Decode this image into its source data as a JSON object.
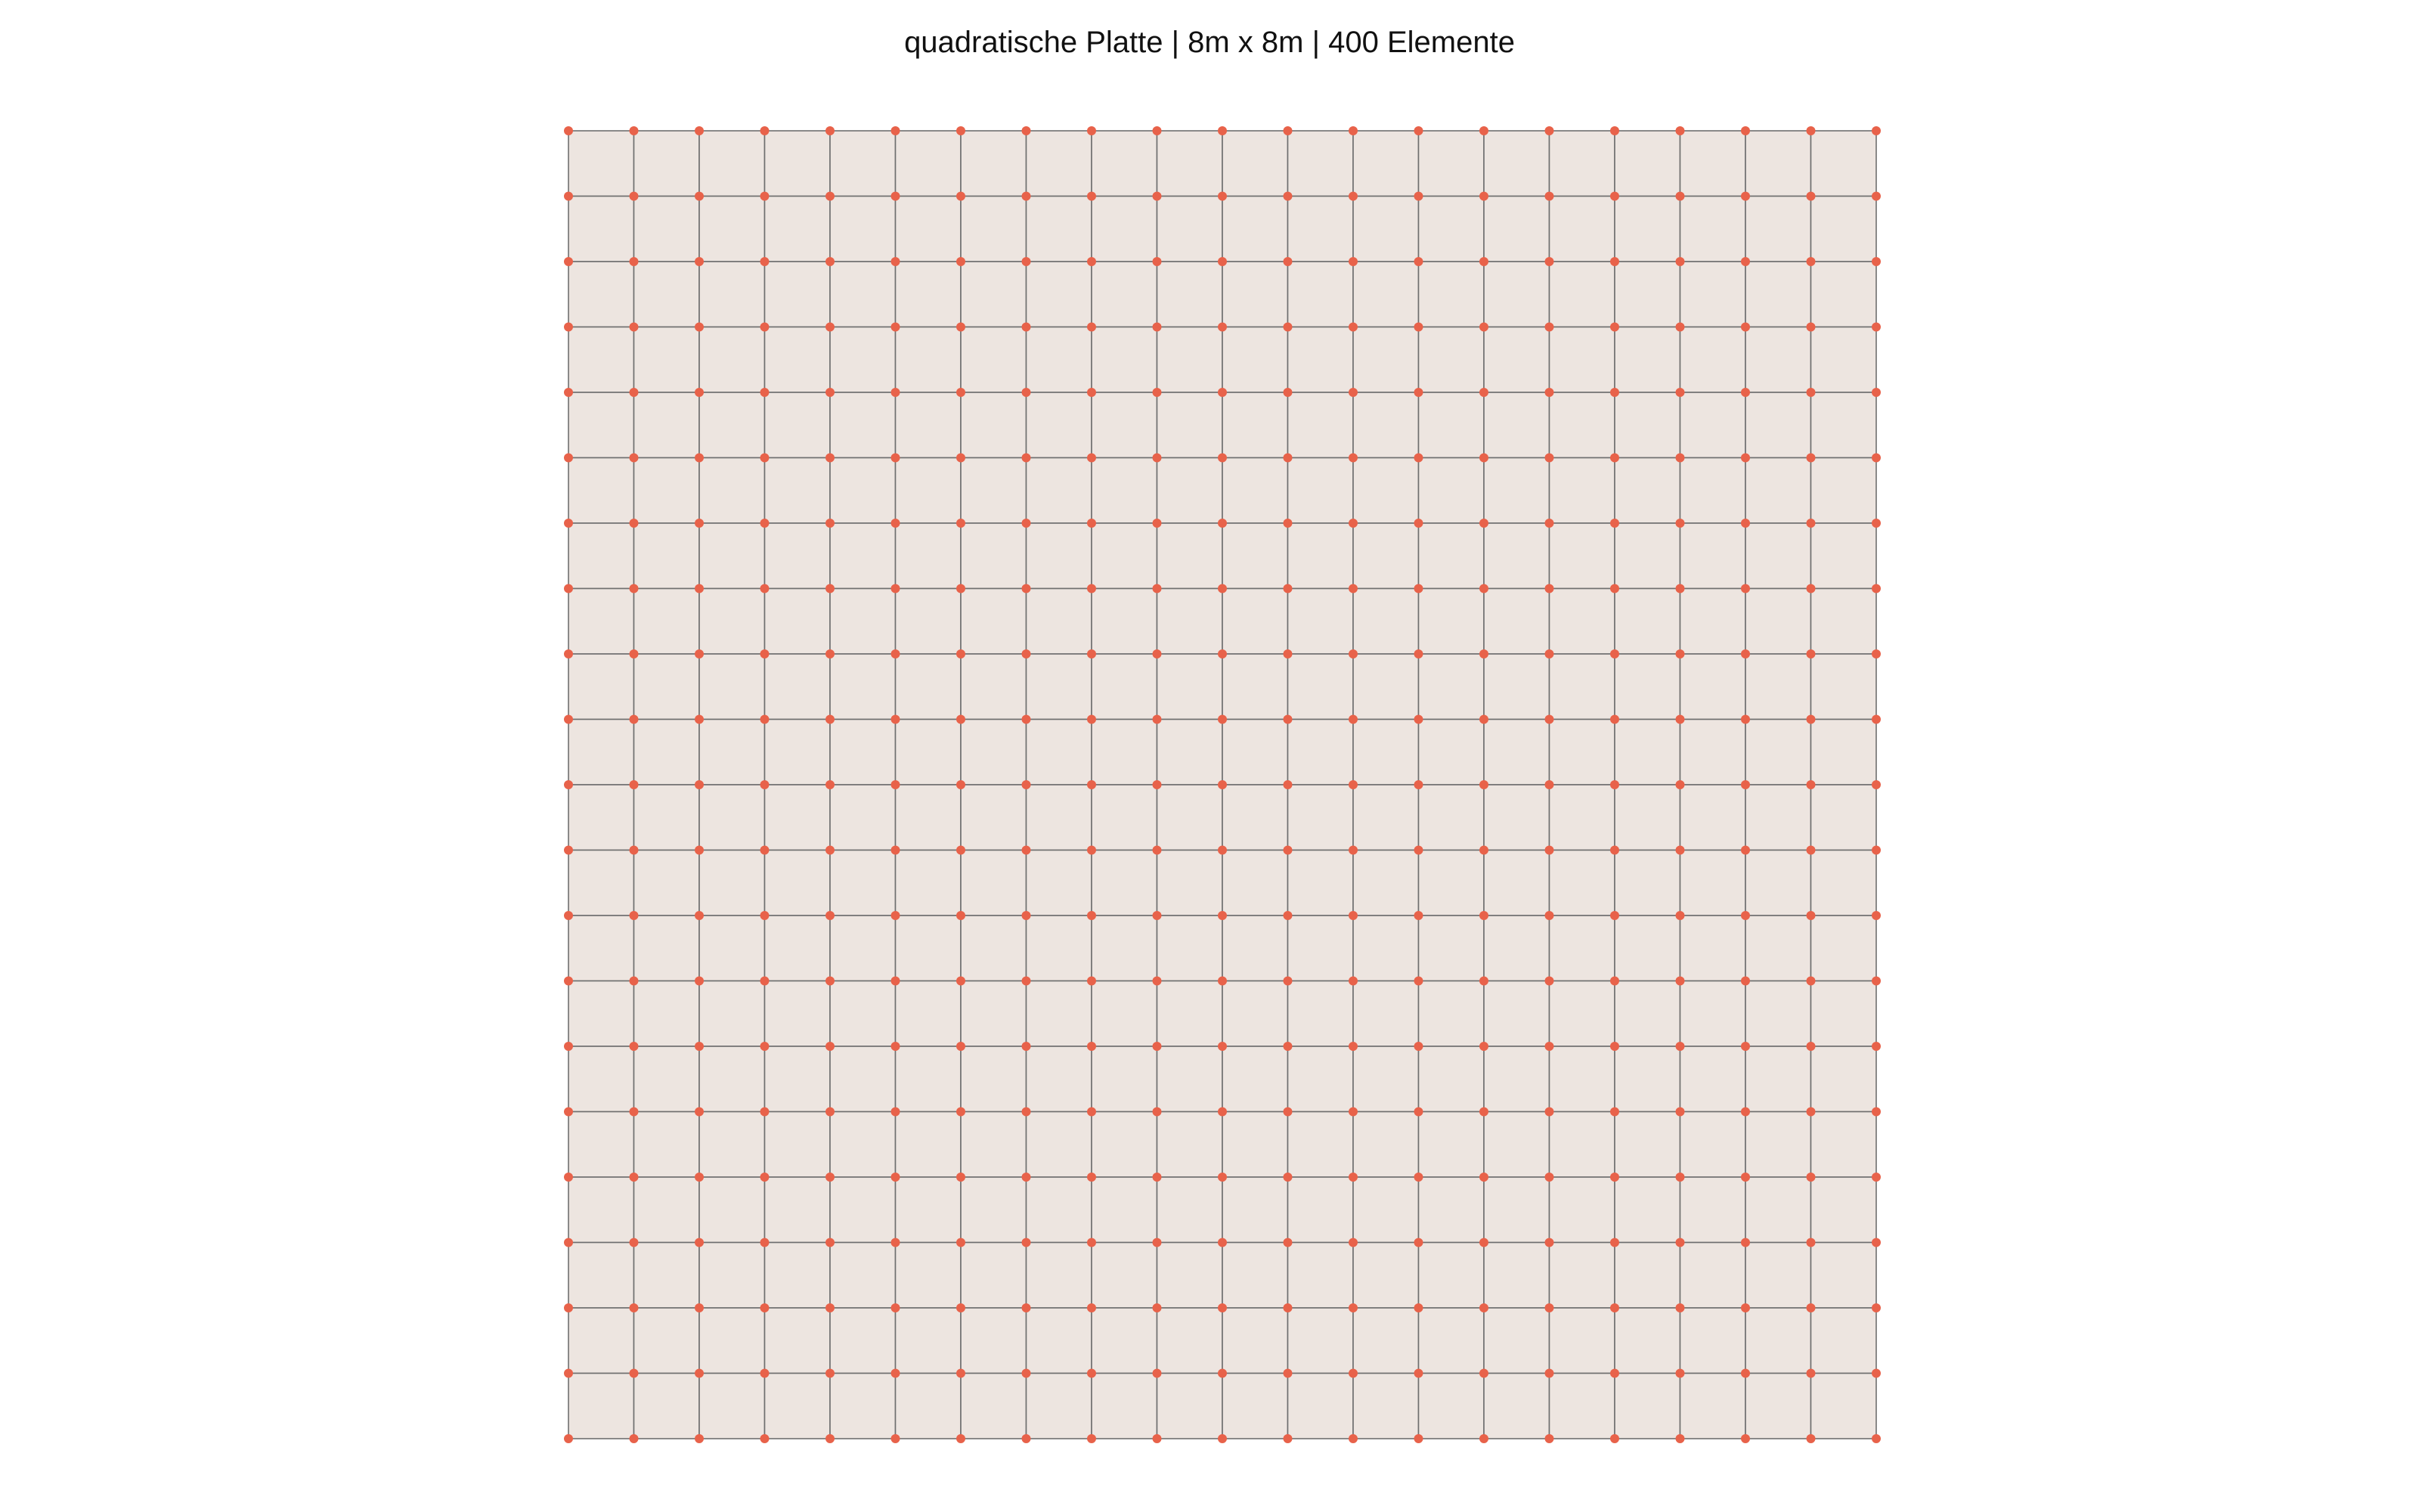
{
  "title": "quadratische Platte | 8m x 8m | 400 Elemente",
  "mesh": {
    "elements_per_side": 20,
    "colors": {
      "element_fill": "#ede5e0",
      "element_edge": "#6f6f6f",
      "node": "#e8624a"
    }
  }
}
